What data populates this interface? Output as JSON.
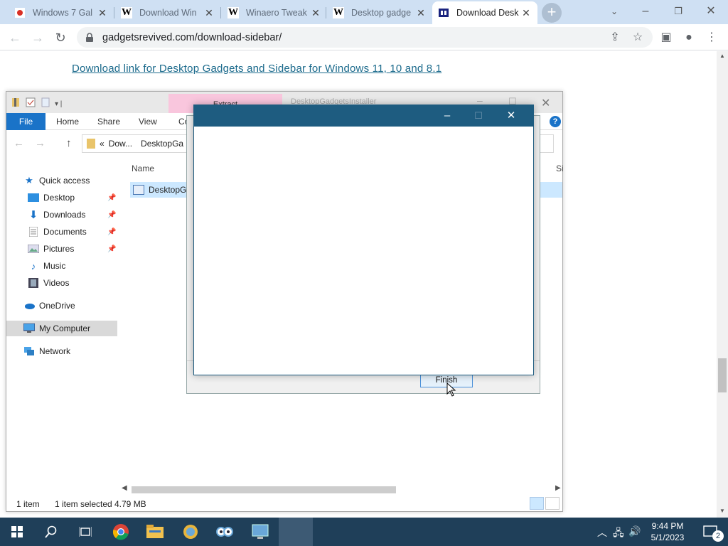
{
  "browser": {
    "tabs": [
      {
        "title": "Windows 7 Gal",
        "favicon": "windows-favicon",
        "active": false
      },
      {
        "title": "Download Win",
        "favicon": "W",
        "active": false
      },
      {
        "title": "Winaero Tweak",
        "favicon": "W",
        "active": false
      },
      {
        "title": "Desktop gadge",
        "favicon": "W",
        "active": false
      },
      {
        "title": "Download Desk",
        "favicon": "gadgets-favicon",
        "active": true
      }
    ],
    "close_glyph": "✕",
    "new_tab_glyph": "+",
    "url": "gadgetsrevived.com/download-sidebar/"
  },
  "page": {
    "link_text": "Download link for Desktop Gadgets and Sidebar for Windows 11, 10 and 8.1"
  },
  "explorer": {
    "extract_tab": "Extract",
    "window_title": "DesktopGadgetsInstaller",
    "ribbon": {
      "file": "File",
      "home": "Home",
      "share": "Share",
      "view": "View",
      "compress": "Co"
    },
    "address": {
      "prefix": "«",
      "seg1": "Dow...",
      "seg2": "DesktopGa"
    },
    "nav": {
      "quick_access": "Quick access",
      "desktop": "Desktop",
      "downloads": "Downloads",
      "documents": "Documents",
      "pictures": "Pictures",
      "music": "Music",
      "videos": "Videos",
      "onedrive": "OneDrive",
      "my_computer": "My Computer",
      "network": "Network"
    },
    "columns": {
      "name": "Name",
      "size": "Si"
    },
    "file_name": "DesktopGa",
    "status": {
      "count": "1 item",
      "selected": "1 item selected",
      "size": "4.79 MB"
    }
  },
  "installer": {
    "finish_label": "Finish"
  },
  "taskbar": {
    "time": "9:44 PM",
    "date": "5/1/2023",
    "notifications": "2"
  }
}
